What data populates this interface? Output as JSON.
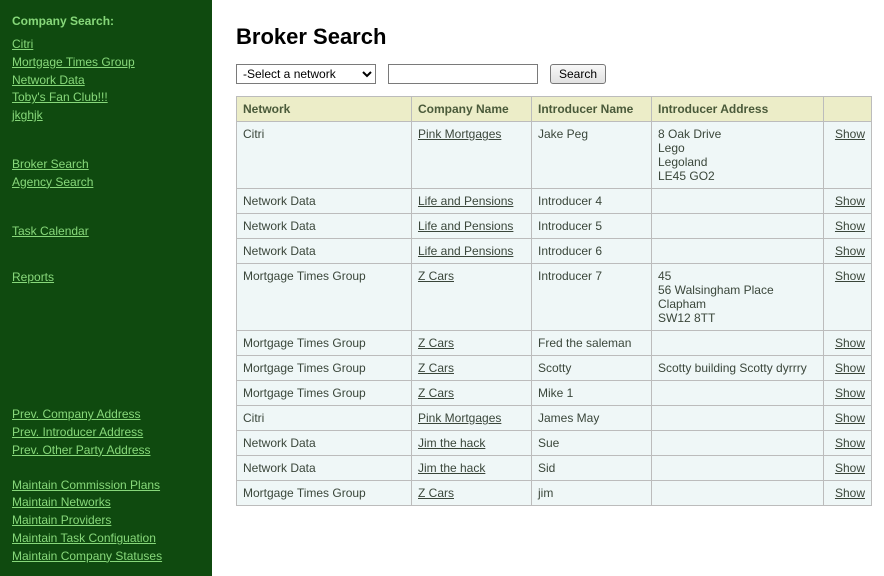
{
  "sidebar": {
    "heading": "Company Search:",
    "companies": [
      {
        "label": "Citri"
      },
      {
        "label": "Mortgage Times Group"
      },
      {
        "label": "Network Data"
      },
      {
        "label": "Toby's Fan Club!!!"
      },
      {
        "label": "jkghjk"
      }
    ],
    "search_links": [
      {
        "label": "Broker Search"
      },
      {
        "label": "Agency Search"
      }
    ],
    "misc_links_1": [
      {
        "label": "Task Calendar"
      }
    ],
    "misc_links_2": [
      {
        "label": "Reports"
      }
    ],
    "prev_links": [
      {
        "label": "Prev. Company Address"
      },
      {
        "label": "Prev. Introducer Address"
      },
      {
        "label": "Prev. Other Party Address"
      }
    ],
    "maintain_links": [
      {
        "label": "Maintain Commission Plans"
      },
      {
        "label": "Maintain Networks"
      },
      {
        "label": "Maintain Providers"
      },
      {
        "label": "Maintain Task Configuation"
      },
      {
        "label": "Maintain Company Statuses"
      }
    ]
  },
  "page": {
    "title": "Broker Search",
    "network_select_placeholder": "-Select a network",
    "search_value": "",
    "search_button": "Search"
  },
  "table": {
    "headers": {
      "network": "Network",
      "company": "Company Name",
      "introducer_name": "Introducer Name",
      "introducer_address": "Introducer Address",
      "action": ""
    },
    "action_label": "Show",
    "rows": [
      {
        "network": "Citri",
        "company": "Pink Mortgages ",
        "introducer_name": "Jake Peg",
        "introducer_address": [
          "8 Oak Drive",
          "Lego",
          "Legoland",
          "LE45 GO2"
        ]
      },
      {
        "network": "Network Data",
        "company": "Life and Pensions",
        "introducer_name": "Introducer 4",
        "introducer_address": []
      },
      {
        "network": "Network Data",
        "company": "Life and Pensions",
        "introducer_name": "Introducer 5",
        "introducer_address": []
      },
      {
        "network": "Network Data",
        "company": "Life and Pensions",
        "introducer_name": "Introducer 6",
        "introducer_address": []
      },
      {
        "network": "Mortgage Times Group",
        "company": "Z Cars",
        "introducer_name": "Introducer 7",
        "introducer_address": [
          "45",
          "56 Walsingham Place",
          "Clapham",
          "SW12 8TT"
        ]
      },
      {
        "network": "Mortgage Times Group",
        "company": "Z Cars",
        "introducer_name": "Fred the saleman",
        "introducer_address": []
      },
      {
        "network": "Mortgage Times Group",
        "company": "Z Cars",
        "introducer_name": "Scotty",
        "introducer_address": [
          "Scotty building Scotty dyrrry"
        ]
      },
      {
        "network": "Mortgage Times Group",
        "company": "Z Cars",
        "introducer_name": "Mike 1",
        "introducer_address": []
      },
      {
        "network": "Citri",
        "company": "Pink Mortgages ",
        "introducer_name": "James May",
        "introducer_address": []
      },
      {
        "network": "Network Data",
        "company": "Jim the hack",
        "introducer_name": "Sue",
        "introducer_address": []
      },
      {
        "network": "Network Data",
        "company": "Jim the hack",
        "introducer_name": "Sid",
        "introducer_address": []
      },
      {
        "network": "Mortgage Times Group",
        "company": "Z Cars",
        "introducer_name": "jim",
        "introducer_address": []
      }
    ]
  }
}
